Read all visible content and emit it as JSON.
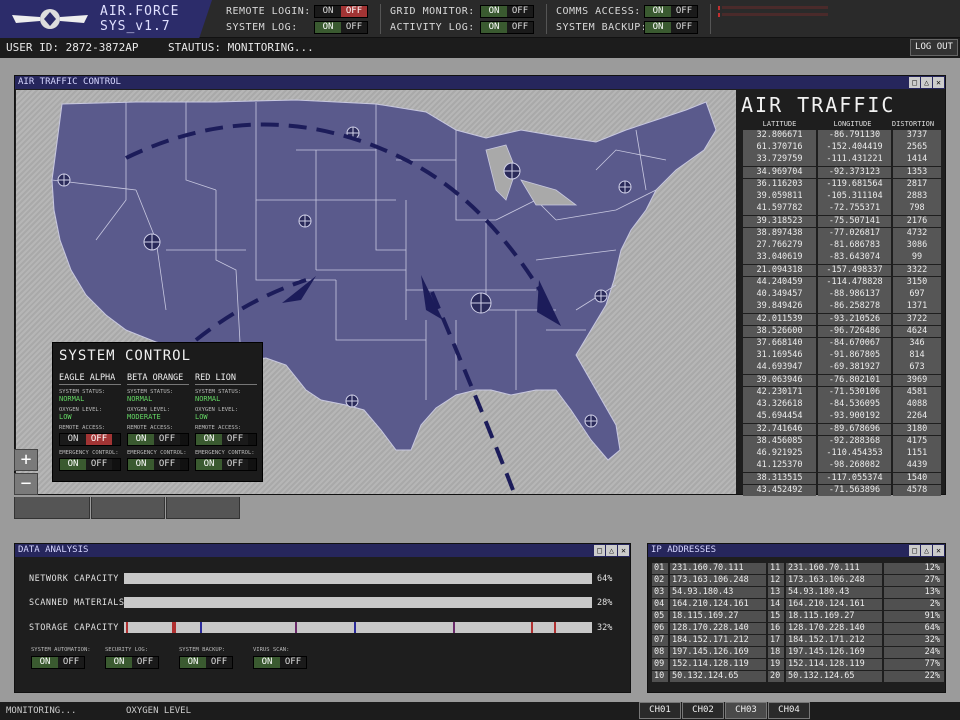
{
  "app": {
    "title_line1": "AIR.FORCE",
    "title_line2": "SYS_v1.7"
  },
  "top_toggles": [
    {
      "label": "REMOTE LOGIN:",
      "on": "ON",
      "off": "OFF",
      "state": "off"
    },
    {
      "label": "SYSTEM LOG:",
      "on": "ON",
      "off": "OFF",
      "state": "on"
    },
    {
      "label": "GRID MONITOR:",
      "on": "ON",
      "off": "OFF",
      "state": "on"
    },
    {
      "label": "ACTIVITY LOG:",
      "on": "ON",
      "off": "OFF",
      "state": "on"
    },
    {
      "label": "COMMS ACCESS:",
      "on": "ON",
      "off": "OFF",
      "state": "on"
    },
    {
      "label": "SYSTEM BACKUP:",
      "on": "ON",
      "off": "OFF",
      "state": "on"
    }
  ],
  "userbar": {
    "user_id": "USER ID: 2872-3872AP",
    "status": "STAUTUS: MONITORING...",
    "logout": "LOG OUT"
  },
  "map_window": {
    "title": "AIR TRAFFIC CONTROL",
    "zoom_in": "+",
    "zoom_out": "−"
  },
  "air_traffic": {
    "title": "AIR TRAFFIC",
    "headers": [
      "LATITUDE",
      "LONGITUDE",
      "DISTORTION"
    ],
    "rows": [
      [
        "32.806671",
        "-86.791130",
        "3737"
      ],
      [
        "61.370716",
        "-152.404419",
        "2565"
      ],
      [
        "33.729759",
        "-111.431221",
        "1414"
      ],
      [
        "34.969704",
        "-92.373123",
        "1353"
      ],
      [
        "36.116203",
        "-119.681564",
        "2817"
      ],
      [
        "39.059811",
        "-105.311104",
        "2883"
      ],
      [
        "41.597782",
        "-72.755371",
        "798"
      ],
      [
        "39.318523",
        "-75.507141",
        "2176"
      ],
      [
        "38.897438",
        "-77.026817",
        "4732"
      ],
      [
        "27.766279",
        "-81.686783",
        "3086"
      ],
      [
        "33.040619",
        "-83.643074",
        "99"
      ],
      [
        "21.094318",
        "-157.498337",
        "3322"
      ],
      [
        "44.240459",
        "-114.478828",
        "3150"
      ],
      [
        "40.349457",
        "-88.986137",
        "697"
      ],
      [
        "39.849426",
        "-86.258278",
        "1371"
      ],
      [
        "42.011539",
        "-93.210526",
        "3722"
      ],
      [
        "38.526600",
        "-96.726486",
        "4624"
      ],
      [
        "37.668140",
        "-84.670067",
        "346"
      ],
      [
        "31.169546",
        "-91.867805",
        "814"
      ],
      [
        "44.693947",
        "-69.381927",
        "673"
      ],
      [
        "39.063946",
        "-76.802101",
        "3969"
      ],
      [
        "42.230171",
        "-71.530106",
        "4581"
      ],
      [
        "43.326618",
        "-84.536095",
        "4088"
      ],
      [
        "45.694454",
        "-93.900192",
        "2264"
      ],
      [
        "32.741646",
        "-89.678696",
        "3180"
      ],
      [
        "38.456085",
        "-92.288368",
        "4175"
      ],
      [
        "46.921925",
        "-110.454353",
        "1151"
      ],
      [
        "41.125370",
        "-98.268082",
        "4439"
      ],
      [
        "38.313515",
        "-117.055374",
        "1540"
      ],
      [
        "43.452492",
        "-71.563896",
        "4578"
      ]
    ]
  },
  "system_control": {
    "title": "SYSTEM CONTROL",
    "units": [
      {
        "name": "EAGLE ALPHA",
        "status_label": "SYSTEM STATUS:",
        "status": "NORMAL",
        "oxygen_label": "OXYGEN LEVEL:",
        "oxygen": "LOW",
        "remote_label": "REMOTE ACCESS:",
        "remote": "off",
        "emergency_label": "EMERGENCY CONTROL:",
        "emergency": "on"
      },
      {
        "name": "BETA ORANGE",
        "status_label": "SYSTEM STATUS:",
        "status": "NORMAL",
        "oxygen_label": "OXYGEN LEVEL:",
        "oxygen": "MODERATE",
        "remote_label": "REMOTE ACCESS:",
        "remote": "on",
        "emergency_label": "EMERGENCY CONTROL:",
        "emergency": "on"
      },
      {
        "name": "RED LION",
        "status_label": "SYSTEM STATUS:",
        "status": "NORMAL",
        "oxygen_label": "OXYGEN LEVEL:",
        "oxygen": "LOW",
        "remote_label": "REMOTE ACCESS:",
        "remote": "on",
        "emergency_label": "EMERGENCY CONTROL:",
        "emergency": "on"
      }
    ],
    "on": "ON",
    "off": "OFF"
  },
  "data_analysis": {
    "title": "DATA ANALYSIS",
    "bars": [
      {
        "label": "NETWORK CAPACITY",
        "pct_text": "64%",
        "value": 64
      },
      {
        "label": "SCANNED MATERIALS",
        "pct_text": "28%",
        "value": 28
      },
      {
        "label": "STORAGE CAPACITY",
        "pct_text": "32%",
        "value": 32
      }
    ],
    "controls": [
      {
        "label": "SYSTEM AUTOMATION:",
        "state": "on"
      },
      {
        "label": "SECURITY LOG:",
        "state": "on"
      },
      {
        "label": "SYSTEM BACKUP:",
        "state": "on"
      },
      {
        "label": "VIRUS SCAN:",
        "state": "on"
      }
    ],
    "on": "ON",
    "off": "OFF",
    "colors": {
      "bar_fill": "#c8c8c8",
      "tick_red": "#b03030",
      "tick_blue": "#2a2a9a",
      "tick_purple": "#6a2a6a"
    }
  },
  "ip_addresses": {
    "title": "IP ADDRESSES",
    "rows": [
      [
        "01",
        "231.160.70.111",
        "11",
        "231.160.70.111",
        "12%"
      ],
      [
        "02",
        "173.163.106.248",
        "12",
        "173.163.106.248",
        "27%"
      ],
      [
        "03",
        "54.93.180.43",
        "13",
        "54.93.180.43",
        "13%"
      ],
      [
        "04",
        "164.210.124.161",
        "14",
        "164.210.124.161",
        "2%"
      ],
      [
        "05",
        "18.115.169.27",
        "15",
        "18.115.169.27",
        "91%"
      ],
      [
        "06",
        "128.170.228.140",
        "16",
        "128.170.228.140",
        "64%"
      ],
      [
        "07",
        "184.152.171.212",
        "17",
        "184.152.171.212",
        "32%"
      ],
      [
        "08",
        "197.145.126.169",
        "18",
        "197.145.126.169",
        "24%"
      ],
      [
        "09",
        "152.114.128.119",
        "19",
        "152.114.128.119",
        "77%"
      ],
      [
        "10",
        "50.132.124.65",
        "20",
        "50.132.124.65",
        "22%"
      ]
    ]
  },
  "bottombar": {
    "status": "MONITORING...",
    "oxygen": "OXYGEN LEVEL",
    "channels": [
      "CH01",
      "CH02",
      "CH03",
      "CH04"
    ],
    "active_channel": "CH03"
  },
  "colors": {
    "accent_navy": "#26265c",
    "map_land": "#5a5a8c",
    "on_green": "#3a5a30",
    "off_red": "#a23434",
    "status_green": "#63d663"
  }
}
